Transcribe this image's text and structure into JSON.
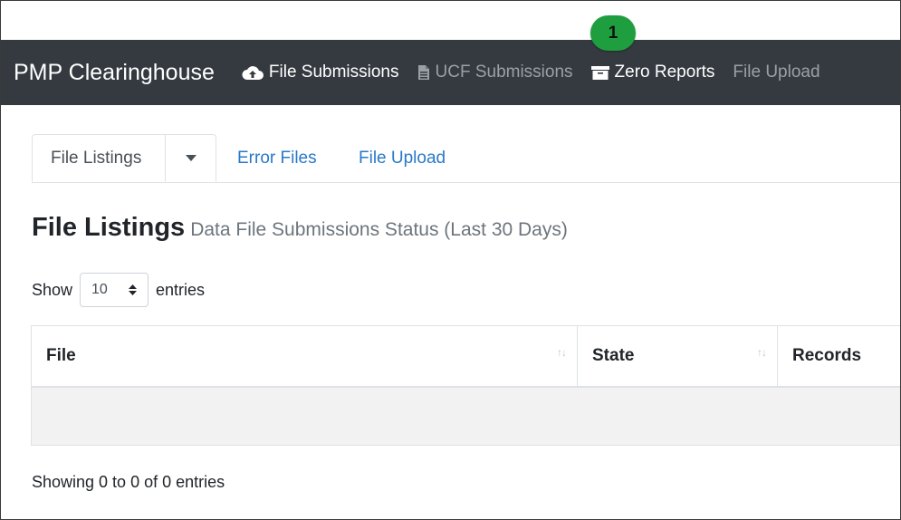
{
  "navbar": {
    "brand": "PMP Clearinghouse",
    "items": [
      {
        "label": "File Submissions",
        "icon": "cloud-upload-icon"
      },
      {
        "label": "UCF Submissions",
        "icon": "file-icon"
      },
      {
        "label": "Zero Reports",
        "icon": "archive-icon"
      },
      {
        "label": "File Upload"
      }
    ]
  },
  "callout": {
    "number": "1",
    "color": "#1e9e3e"
  },
  "tabs": {
    "file_listings": "File Listings",
    "error_files": "Error Files",
    "file_upload": "File Upload"
  },
  "heading": {
    "title": "File Listings",
    "subtitle": "Data File Submissions Status (Last 30 Days)"
  },
  "length_menu": {
    "show": "Show",
    "value": "10",
    "entries": "entries"
  },
  "table": {
    "columns": [
      "File",
      "State",
      "Records"
    ],
    "sort_icon": "sort-icon",
    "rows": []
  },
  "info": "Showing 0 to 0 of 0 entries",
  "colors": {
    "navbar": "#343a40",
    "link": "#2a78c8",
    "badge": "#1e9e3e"
  }
}
